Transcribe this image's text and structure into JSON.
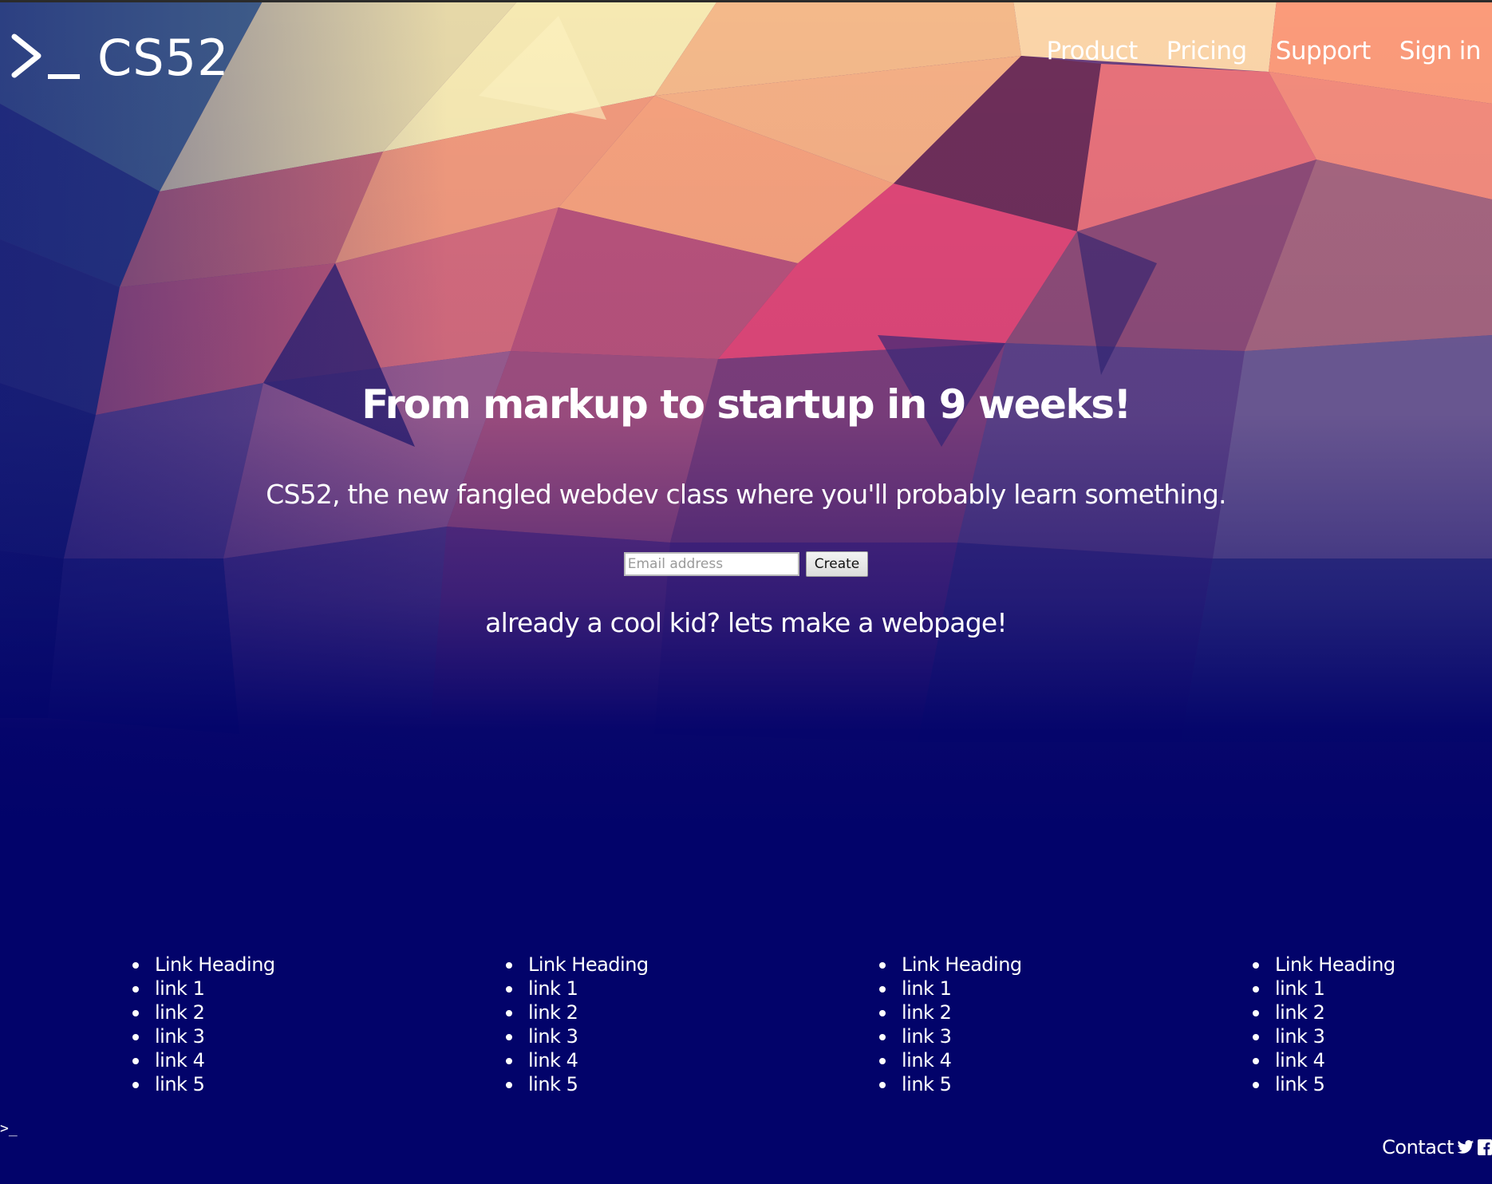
{
  "header": {
    "logo_text": "CS52",
    "nav": [
      "Product",
      "Pricing",
      "Support",
      "Sign in"
    ]
  },
  "hero": {
    "headline": "From markup to startup in 9 weeks!",
    "subhead": "CS52, the new fangled webdev class where you'll probably learn something.",
    "email_placeholder": "Email address",
    "create_label": "Create",
    "cool_kid": "already a cool kid? lets make a webpage!"
  },
  "footer": {
    "columns": [
      {
        "heading": "Link Heading",
        "links": [
          "link 1",
          "link 2",
          "link 3",
          "link 4",
          "link 5"
        ]
      },
      {
        "heading": "Link Heading",
        "links": [
          "link 1",
          "link 2",
          "link 3",
          "link 4",
          "link 5"
        ]
      },
      {
        "heading": "Link Heading",
        "links": [
          "link 1",
          "link 2",
          "link 3",
          "link 4",
          "link 5"
        ]
      },
      {
        "heading": "Link Heading",
        "links": [
          "link 1",
          "link 2",
          "link 3",
          "link 4",
          "link 5"
        ]
      }
    ],
    "mini_prompt": ">_",
    "contact_label": "Contact",
    "icons": [
      "twitter-icon",
      "facebook-icon"
    ]
  },
  "colors": {
    "background": "#02036a",
    "text": "#ffffff"
  }
}
